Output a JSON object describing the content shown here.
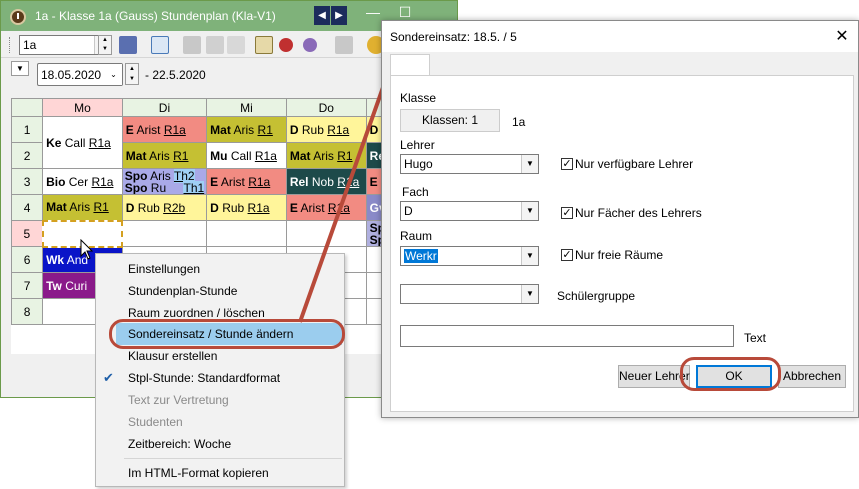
{
  "main_window": {
    "title": "1a - Klasse 1a (Gauss)  Stundenplan  (Kla-V1)",
    "class_combo_value": "1a",
    "date_value": "18.05.2020",
    "date_to": "- 22.5.2020",
    "days": [
      "Mo",
      "Di",
      "Mi",
      "Do"
    ],
    "periods": [
      "1",
      "2",
      "3",
      "4",
      "5",
      "6",
      "7",
      "8"
    ]
  },
  "timetable": {
    "mo_1_2": {
      "subject": "Ke",
      "teacher": "Call",
      "room": "R1a"
    },
    "mo_3": {
      "subject": "Bio",
      "teacher": "Cer",
      "room": "R1a"
    },
    "mo_4": {
      "subject": "Mat",
      "teacher": "Aris",
      "room": "R1"
    },
    "mo_6": {
      "subject": "Wk",
      "teacher": "And"
    },
    "mo_7": {
      "subject": "Tw",
      "teacher": "Curi"
    },
    "di_1": {
      "subject": "E",
      "teacher": "Arist",
      "room": "R1a"
    },
    "di_2": {
      "subject": "Mat",
      "teacher": "Aris",
      "room": "R1"
    },
    "di_3a": {
      "subject": "Spo",
      "teacher": "Aris",
      "room": "Th2"
    },
    "di_3b": {
      "subject": "Spo",
      "teacher": "Ru",
      "room": "Th1"
    },
    "di_4": {
      "subject": "D",
      "teacher": "Rub",
      "room": "R2b"
    },
    "mi_1": {
      "subject": "Mat",
      "teacher": "Aris",
      "room": "R1"
    },
    "mi_2": {
      "subject": "Mu",
      "teacher": "Call",
      "room": "R1a"
    },
    "mi_3": {
      "subject": "E",
      "teacher": "Arist",
      "room": "R1a"
    },
    "mi_4": {
      "subject": "D",
      "teacher": "Rub",
      "room": "R1a"
    },
    "do_1": {
      "subject": "D",
      "teacher": "Rub",
      "room": "R1a"
    },
    "do_2": {
      "subject": "Mat",
      "teacher": "Aris",
      "room": "R1"
    },
    "do_3": {
      "subject": "Rel",
      "teacher": "Nob",
      "room": "R1a"
    },
    "do_4": {
      "subject": "E",
      "teacher": "Arist",
      "room": "R1a"
    },
    "partial_col": [
      "D",
      "Re",
      "E",
      "Gv",
      "Sp",
      "Sp"
    ]
  },
  "context_menu": {
    "items": [
      "Einstellungen",
      "Stundenplan-Stunde",
      "Raum zuordnen / löschen",
      "Sondereinsatz / Stunde ändern",
      "Klausur erstellen",
      "Stpl-Stunde: Standardformat",
      "Text zur Vertretung",
      "Studenten",
      "Zeitbereich: Woche",
      "Im HTML-Format kopieren"
    ]
  },
  "dialog": {
    "title": "Sondereinsatz:  18.5. / 5",
    "klasse_label": "Klasse",
    "klassen_button": "Klassen: 1",
    "klassen_value": "1a",
    "lehrer_label": "Lehrer",
    "lehrer_value": "Hugo",
    "lehrer_check": "Nur verfügbare Lehrer",
    "fach_label": "Fach",
    "fach_value": "D",
    "fach_check": "Nur Fächer des Lehrers",
    "raum_label": "Raum",
    "raum_value": "Werkr",
    "raum_check": "Nur freie Räume",
    "schuelergruppe_label": "Schülergruppe",
    "text_label": "Text",
    "btn_new_teacher": "Neuer Lehrer",
    "btn_ok": "OK",
    "btn_cancel": "Abbrechen"
  },
  "colors": {
    "annotation": "#b84a3a",
    "menu_highlight": "#9bcdee",
    "window_title": "#7fb27a"
  }
}
